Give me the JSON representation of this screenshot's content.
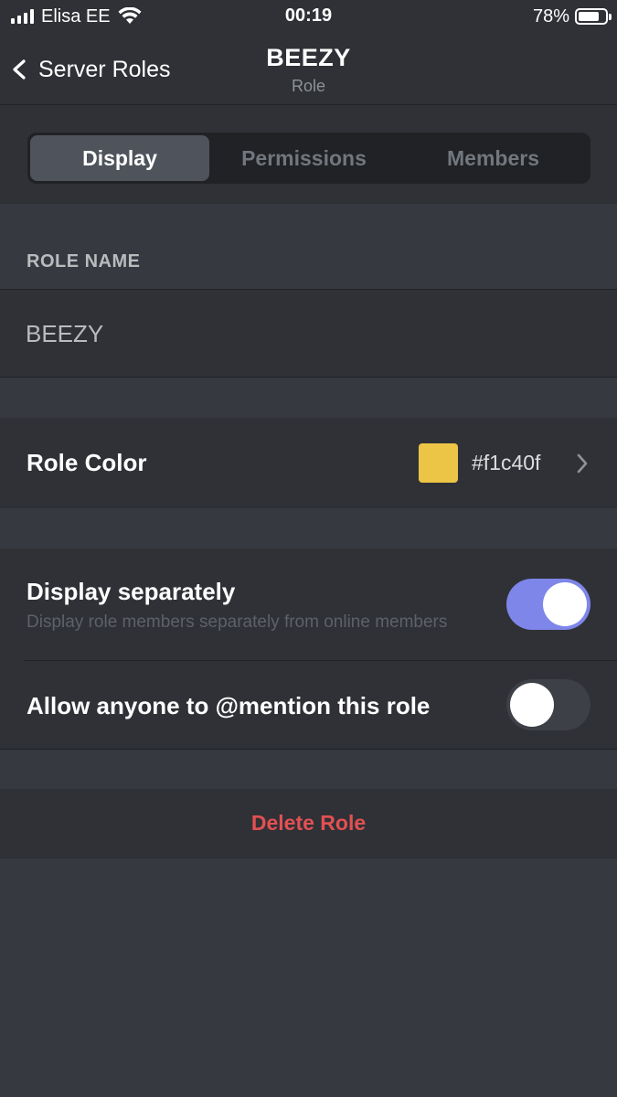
{
  "status_bar": {
    "carrier": "Elisa EE",
    "time": "00:19",
    "battery_percent": "78%",
    "battery_level": 0.78,
    "icons": [
      "signal-icon",
      "wifi-icon",
      "battery-icon"
    ]
  },
  "nav": {
    "back_label": "Server Roles",
    "title": "BEEZY",
    "subtitle": "Role"
  },
  "tabs": [
    {
      "label": "Display",
      "active": true
    },
    {
      "label": "Permissions",
      "active": false
    },
    {
      "label": "Members",
      "active": false
    }
  ],
  "role_name": {
    "header": "ROLE NAME",
    "value": "BEEZY"
  },
  "role_color": {
    "label": "Role Color",
    "hex": "#f1c40f",
    "swatch_color": "#ecc546"
  },
  "display_separately": {
    "label": "Display separately",
    "description": "Display role members separately from online members",
    "enabled": true
  },
  "mentionable": {
    "label": "Allow anyone to @mention this role",
    "enabled": false
  },
  "delete": {
    "label": "Delete Role"
  },
  "colors": {
    "background": "#36393f",
    "surface": "#2f3136",
    "toggle_on": "#7e86e9",
    "danger": "#e25052"
  }
}
